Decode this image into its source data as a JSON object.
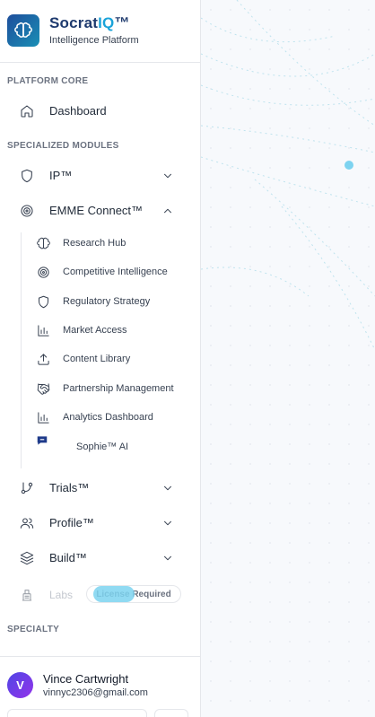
{
  "brand": {
    "name_prefix": "Socrat",
    "name_accent": "IQ",
    "name_suffix": "™",
    "subtitle": "Intelligence Platform",
    "accent_color": "#1aa3d9"
  },
  "sections": {
    "platform_core": "PLATFORM CORE",
    "specialized_modules": "SPECIALIZED MODULES",
    "specialty": "SPECIALTY"
  },
  "nav": {
    "dashboard": {
      "label": "Dashboard",
      "icon": "home-icon"
    },
    "ip": {
      "label": "IP™",
      "icon": "shield-icon",
      "expanded": false
    },
    "emme": {
      "label": "EMME Connect™",
      "icon": "target-icon",
      "expanded": true
    },
    "trials": {
      "label": "Trials™",
      "icon": "git-branch-icon",
      "expanded": false
    },
    "profile": {
      "label": "Profile™",
      "icon": "users-icon",
      "expanded": false
    },
    "build": {
      "label": "Build™",
      "icon": "layers-icon",
      "expanded": false
    },
    "labs": {
      "label": "Labs",
      "icon": "flask-icon",
      "badge": "License Required"
    }
  },
  "emme_items": [
    {
      "label": "Research Hub",
      "icon": "brain-icon"
    },
    {
      "label": "Competitive Intelligence",
      "icon": "target-icon"
    },
    {
      "label": "Regulatory Strategy",
      "icon": "shield-icon"
    },
    {
      "label": "Market Access",
      "icon": "bar-chart-icon"
    },
    {
      "label": "Content Library",
      "icon": "upload-icon"
    },
    {
      "label": "Partnership Management",
      "icon": "handshake-icon"
    },
    {
      "label": "Analytics Dashboard",
      "icon": "bar-chart-icon"
    },
    {
      "label": "Sophie™ AI",
      "icon": "chat-icon"
    }
  ],
  "user": {
    "initial": "V",
    "name": "Vince Cartwright",
    "email": "vinnyc2306@gmail.com"
  }
}
